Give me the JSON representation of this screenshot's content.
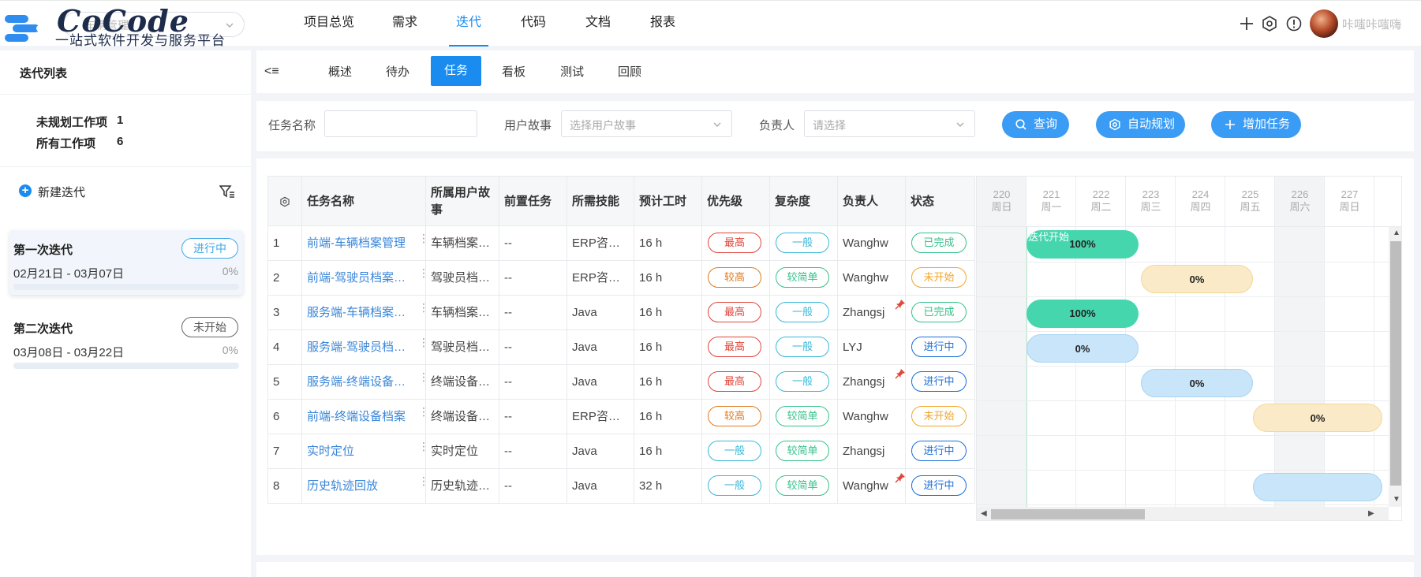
{
  "header": {
    "brand": "CoCode",
    "tagline": "一站式软件开发与服务平台",
    "project_select_value": "车辆管理",
    "nav": [
      "项目总览",
      "需求",
      "迭代",
      "代码",
      "文档",
      "报表"
    ],
    "active_nav": "迭代",
    "username": "咔嗤咔嗤嗨"
  },
  "sidebar": {
    "title": "迭代列表",
    "stats": [
      {
        "label": "未规划工作项",
        "value": "1"
      },
      {
        "label": "所有工作项",
        "value": "6"
      }
    ],
    "new_iteration": "新建迭代",
    "iterations": [
      {
        "name": "第一次迭代",
        "status": "进行中",
        "dates": "02月21日 - 03月07日",
        "progress": "0%"
      },
      {
        "name": "第二次迭代",
        "status": "未开始",
        "dates": "03月08日 - 03月22日",
        "progress": "0%"
      }
    ]
  },
  "tabs": [
    "概述",
    "待办",
    "任务",
    "看板",
    "测试",
    "回顾"
  ],
  "active_tab": "任务",
  "filters": {
    "task_name_label": "任务名称",
    "task_name_value": "",
    "story_label": "用户故事",
    "story_placeholder": "选择用户故事",
    "owner_label": "负责人",
    "owner_placeholder": "请选择",
    "query_btn": "查询",
    "auto_plan_btn": "自动规划",
    "add_task_btn": "增加任务"
  },
  "table": {
    "headers": [
      "任务名称",
      "所属用户故事",
      "前置任务",
      "所需技能",
      "预计工时",
      "优先级",
      "复杂度",
      "负责人",
      "状态"
    ],
    "rows": [
      {
        "no": "1",
        "name": "前端-车辆档案管理",
        "story": "车辆档案…",
        "pre": "--",
        "skill": "ERP咨…",
        "hours": "16 h",
        "priority": "最高",
        "complexity": "一般",
        "owner": "Wanghw",
        "pinned": false,
        "status": "已完成"
      },
      {
        "no": "2",
        "name": "前端-驾驶员档案管理",
        "story": "驾驶员档…",
        "pre": "--",
        "skill": "ERP咨…",
        "hours": "16 h",
        "priority": "较高",
        "complexity": "较简单",
        "owner": "Wanghw",
        "pinned": false,
        "status": "未开始"
      },
      {
        "no": "3",
        "name": "服务端-车辆档案管理",
        "story": "车辆档案…",
        "pre": "--",
        "skill": "Java",
        "hours": "16 h",
        "priority": "最高",
        "complexity": "一般",
        "owner": "Zhangsj",
        "pinned": true,
        "status": "已完成"
      },
      {
        "no": "4",
        "name": "服务端-驾驶员档案…",
        "story": "驾驶员档…",
        "pre": "--",
        "skill": "Java",
        "hours": "16 h",
        "priority": "最高",
        "complexity": "一般",
        "owner": "LYJ",
        "pinned": false,
        "status": "进行中"
      },
      {
        "no": "5",
        "name": "服务端-终端设备档…",
        "story": "终端设备…",
        "pre": "--",
        "skill": "Java",
        "hours": "16 h",
        "priority": "最高",
        "complexity": "一般",
        "owner": "Zhangsj",
        "pinned": true,
        "status": "进行中"
      },
      {
        "no": "6",
        "name": "前端-终端设备档案",
        "story": "终端设备…",
        "pre": "--",
        "skill": "ERP咨…",
        "hours": "16 h",
        "priority": "较高",
        "complexity": "较简单",
        "owner": "Wanghw",
        "pinned": false,
        "status": "未开始"
      },
      {
        "no": "7",
        "name": "实时定位",
        "story": "实时定位",
        "pre": "--",
        "skill": "Java",
        "hours": "16 h",
        "priority": "一般",
        "complexity": "较简单",
        "owner": "Zhangsj",
        "pinned": false,
        "status": "进行中"
      },
      {
        "no": "8",
        "name": "历史轨迹回放",
        "story": "历史轨迹…",
        "pre": "--",
        "skill": "Java",
        "hours": "32 h",
        "priority": "一般",
        "complexity": "较简单",
        "owner": "Wanghw",
        "pinned": true,
        "status": "进行中"
      }
    ]
  },
  "gantt": {
    "days": [
      {
        "date": "220",
        "weekday": "周日"
      },
      {
        "date": "221",
        "weekday": "周一"
      },
      {
        "date": "222",
        "weekday": "周二"
      },
      {
        "date": "223",
        "weekday": "周三"
      },
      {
        "date": "224",
        "weekday": "周四"
      },
      {
        "date": "225",
        "weekday": "周五"
      },
      {
        "date": "226",
        "weekday": "周六"
      },
      {
        "date": "227",
        "weekday": "周日"
      }
    ],
    "start_label": "迭代开始",
    "bars": [
      "100%",
      "0%",
      "100%",
      "0%",
      "0%",
      "0%",
      ""
    ]
  },
  "colors": {
    "accent": "#1a8cf0",
    "done_green": "#46d6ae",
    "pending_amber": "#fbeac8",
    "running_blue": "#c9e5fa"
  }
}
